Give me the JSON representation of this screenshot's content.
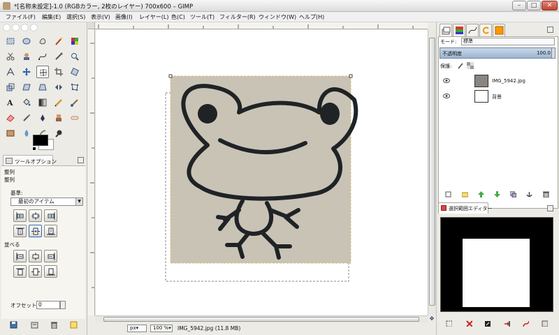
{
  "window": {
    "title": "*[名称未設定]-1.0 (RGBカラー, 2枚のレイヤー) 700x600 – GIMP",
    "controls": {
      "minimize": "–",
      "maximize": "□",
      "close": "✕"
    }
  },
  "menu": {
    "file": "ファイル(F)",
    "edit": "編集(E)",
    "select": "選択(S)",
    "view": "表示(V)",
    "image": "画像(I)",
    "layer": "レイヤー(L)",
    "colors": "色(C)",
    "tools": "ツール(T)",
    "filters": "フィルター(R)",
    "windows": "ウィンドウ(W)",
    "help": "ヘルプ(H)"
  },
  "toolbox": {
    "selected_tool": "move-tool",
    "fg_color": "#000000",
    "bg_color": "#ffffff"
  },
  "tool_options": {
    "tab_label": "ツールオプション",
    "title": "整列",
    "section_align": "整列",
    "relative_label": "基準:",
    "relative_value": "最初のアイテム",
    "section_distribute": "並べる",
    "offset_label": "オフセット:",
    "offset_value": "0"
  },
  "statusbar": {
    "unit": "px▾",
    "zoom": "100 %▾",
    "info": "IMG_5942.jpg (11.8 MB)"
  },
  "layers": {
    "mode_label": "モード:",
    "mode_value": "標準",
    "opacity_label": "不透明度",
    "opacity_value": "100.0",
    "lock_label": "保護:",
    "items": [
      {
        "name": "IMG_5942.jpg",
        "visible": true
      },
      {
        "name": "背景",
        "visible": true
      }
    ]
  },
  "selection_editor": {
    "tab_label": "選択範囲エディター"
  },
  "colors": {
    "accent": "#6c87a8",
    "paper": "#c9c3b6",
    "ink": "#1f2326"
  }
}
